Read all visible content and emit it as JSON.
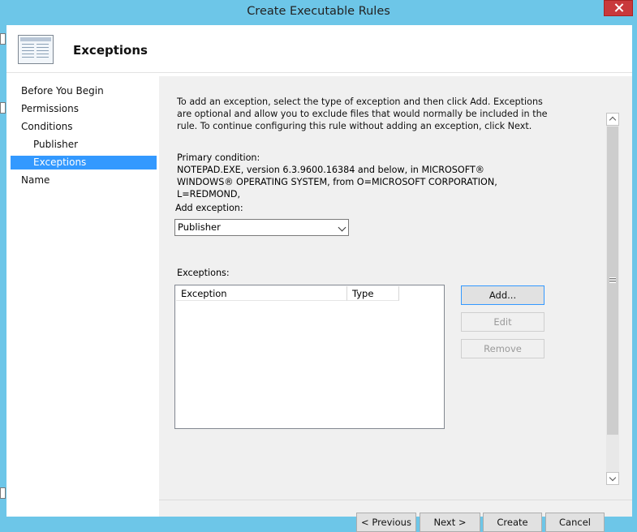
{
  "window": {
    "title": "Create Executable Rules"
  },
  "header": {
    "title": "Exceptions"
  },
  "nav": {
    "items": [
      {
        "label": "Before You Begin"
      },
      {
        "label": "Permissions"
      },
      {
        "label": "Conditions"
      },
      {
        "label": "Publisher"
      },
      {
        "label": "Exceptions",
        "selected": true
      },
      {
        "label": "Name"
      }
    ]
  },
  "content": {
    "intro": "To add an exception, select the type of exception and then click Add. Exceptions are optional and allow you to exclude files that would normally be included in the rule. To continue configuring this rule without adding an exception, click Next.",
    "primary_condition_label": "Primary condition:",
    "primary_condition_text": "NOTEPAD.EXE, version 6.3.9600.16384 and below, in MICROSOFT® WINDOWS® OPERATING SYSTEM, from O=MICROSOFT CORPORATION, L=REDMOND,",
    "add_exception_label": "Add exception:",
    "add_exception_value": "Publisher",
    "exceptions_label": "Exceptions:",
    "columns": [
      "Exception",
      "Type"
    ],
    "buttons": {
      "add": "Add...",
      "edit": "Edit",
      "remove": "Remove"
    }
  },
  "footer": {
    "previous": "< Previous",
    "next": "Next >",
    "create": "Create",
    "cancel": "Cancel"
  },
  "colors": {
    "titlebar": "#6dc6e8",
    "selection": "#3399ff",
    "close": "#c9393b"
  }
}
